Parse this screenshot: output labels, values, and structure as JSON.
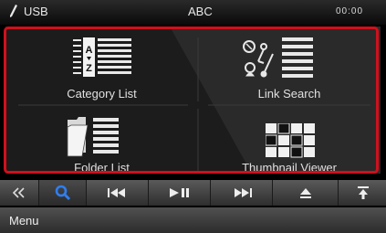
{
  "status_bar": {
    "source_label": "USB",
    "title": "ABC",
    "clock": "00:00"
  },
  "panel": {
    "category_list_label": "Category List",
    "link_search_label": "Link Search",
    "folder_list_label": "Folder List",
    "thumbnail_viewer_label": "Thumbnail Viewer"
  },
  "transport": {
    "buttons": [
      "back",
      "search",
      "previous",
      "play-pause",
      "next",
      "eject",
      "scroll-top"
    ]
  },
  "bottom_bar": {
    "menu_label": "Menu"
  },
  "colors": {
    "highlight_border": "#d0101c",
    "search_icon": "#2f7ef0"
  }
}
